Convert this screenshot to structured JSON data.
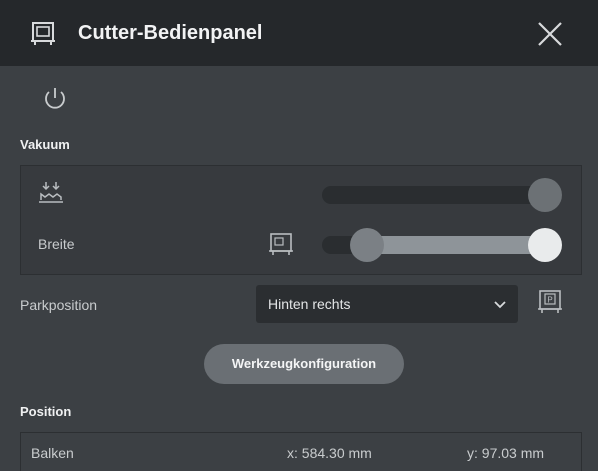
{
  "window": {
    "title": "Cutter-Bedienpanel",
    "title_icon": "panel-icon",
    "close_icon": "close-icon"
  },
  "power": {
    "icon": "power-icon"
  },
  "vakuum": {
    "label": "Vakuum",
    "icon": "vacuum-icon",
    "strength_level": 1.0,
    "breite": {
      "label": "Breite",
      "icon": "panel-icon",
      "range_low": 0.2,
      "range_high": 1.0
    }
  },
  "parkposition": {
    "label": "Parkposition",
    "selected": "Hinten rechts",
    "icon": "park-icon"
  },
  "tool_button": {
    "label": "Werkzeugkonfiguration"
  },
  "position": {
    "label": "Position",
    "row": {
      "name": "Balken",
      "x": "x: 584.30 mm",
      "y": "y: 97.03 mm"
    }
  },
  "colors": {
    "background": "#3c4044",
    "titlebar": "#25282b",
    "button": "#6a6f74",
    "knob_active": "#e9ebec"
  }
}
